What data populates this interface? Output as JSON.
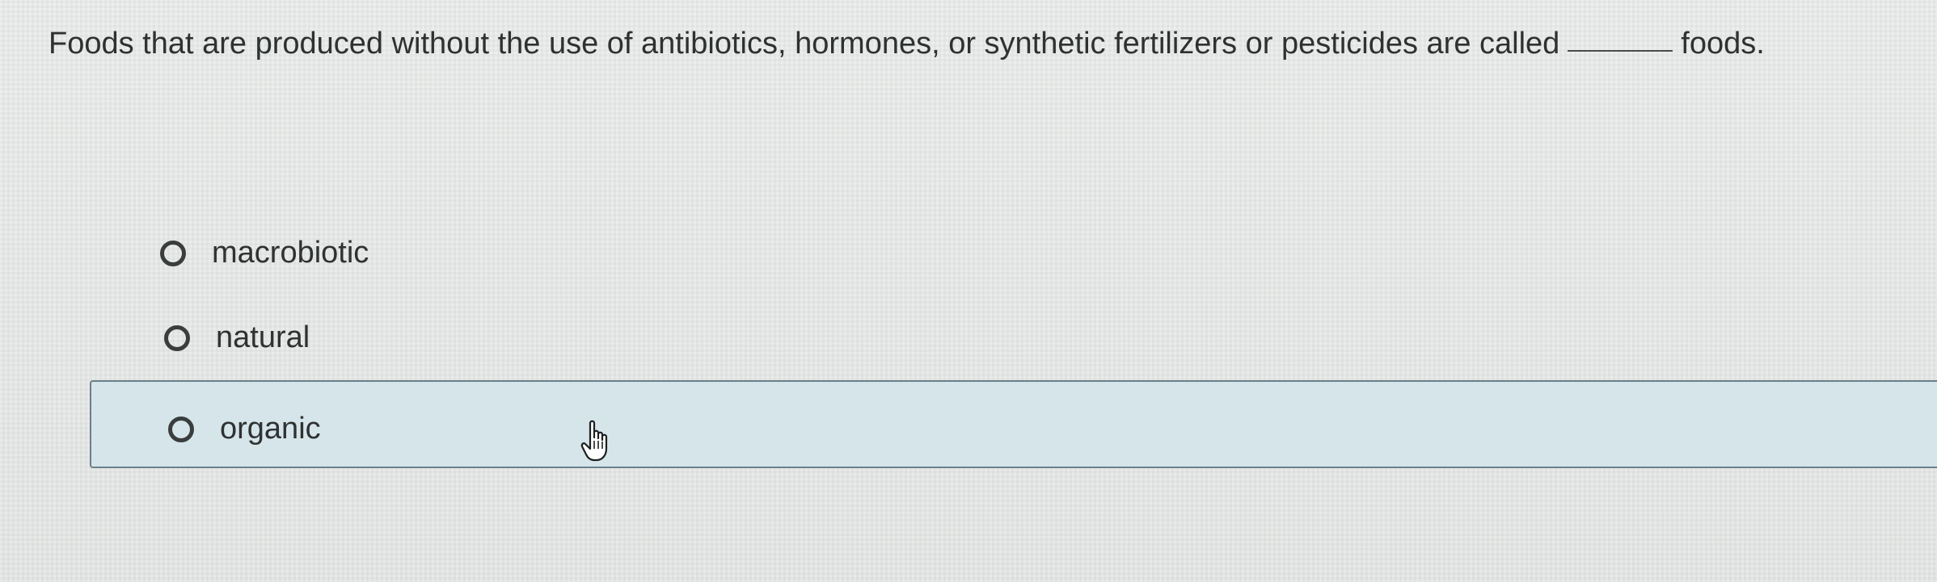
{
  "question": {
    "text_before": "Foods that are produced without the use of antibiotics, hormones, or synthetic fertilizers or pesticides are called",
    "text_after": "foods."
  },
  "options": [
    {
      "label": "macrobiotic",
      "selected": false
    },
    {
      "label": "natural",
      "selected": false
    },
    {
      "label": "organic",
      "selected": false,
      "hovered": true
    }
  ],
  "cursor": {
    "icon": "hand-pointer-icon"
  },
  "colors": {
    "background": "#e6e8e7",
    "hover_highlight": "#d5e5ea",
    "hover_border": "#6b7f8a",
    "text": "#2f3232"
  }
}
